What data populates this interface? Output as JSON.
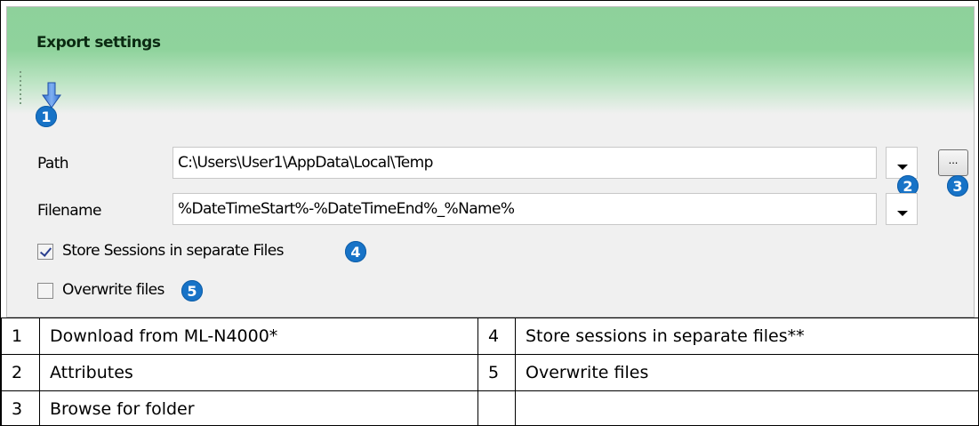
{
  "panel": {
    "title": "Export settings",
    "path_label": "Path",
    "path_value": "C:\\Users\\User1\\AppData\\Local\\Temp",
    "filename_label": "Filename",
    "filename_value": "%DateTimeStart%-%DateTimeEnd%_%Name%",
    "browse_label": "...",
    "store_sessions_label": "Store Sessions in separate Files",
    "store_sessions_checked": true,
    "overwrite_label": "Overwrite files",
    "overwrite_checked": false
  },
  "callouts": [
    "1",
    "2",
    "3",
    "4",
    "5"
  ],
  "legend": {
    "rows": [
      {
        "n1": "1",
        "t1": "Download from ML-N4000*",
        "n2": "4",
        "t2": "Store sessions in separate files**"
      },
      {
        "n1": "2",
        "t1": "Attributes",
        "n2": "5",
        "t2": "Overwrite files"
      },
      {
        "n1": "3",
        "t1": "Browse for folder",
        "n2": "",
        "t2": ""
      }
    ]
  },
  "colors": {
    "header_green": "#8ed19b",
    "callout_blue": "#1773c7"
  },
  "icons": {
    "download_arrow": "arrow-down-icon"
  }
}
